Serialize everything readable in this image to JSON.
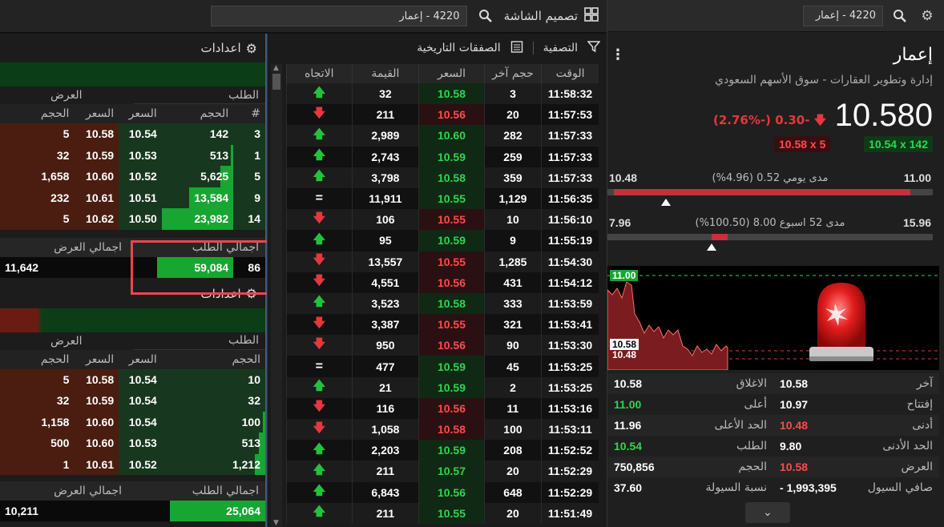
{
  "dashboard": {
    "title": "تصميم الشاشة",
    "search_value": "4220 - إعمار"
  },
  "stock": {
    "search_value": "4220 - إعمار",
    "name": "إعمار",
    "sector": "إدارة وتطوير العقارات - سوق الأسهم السعودي",
    "last": "10.580",
    "change": "0.30-",
    "change_pct": "(2.76%-)",
    "bid": "10.54 x 142",
    "ask": "10.58 x 5",
    "day_range": {
      "low": "10.48",
      "high": "11.00",
      "label": "مدى يومي 0.52 (4.96%)",
      "fill_from": 0.02,
      "fill_to": 0.93,
      "marker": 0.18
    },
    "week52_range": {
      "low": "7.96",
      "high": "15.96",
      "label": "مدى 52 اسبوع 8.00 (100.50%)",
      "fill_from": 0.32,
      "fill_to": 0.37,
      "marker": 0.32
    },
    "chart": {
      "top_label": "11.00",
      "price_label": "10.58",
      "prev_label": "10.48"
    },
    "stats": [
      {
        "l1": "آخر",
        "v1": "10.58",
        "l2": "الاغلاق",
        "v2": "10.58",
        "c1": "#ffffff",
        "c2": "#ffffff"
      },
      {
        "l1": "إفتتاح",
        "v1": "10.97",
        "l2": "أعلى",
        "v2": "11.00",
        "c1": "#ffffff",
        "c2": "#2ed54e"
      },
      {
        "l1": "أدنى",
        "v1": "10.48",
        "l2": "الحد الأعلى",
        "v2": "11.96",
        "c1": "#ff4a4a",
        "c2": "#ffffff"
      },
      {
        "l1": "الحد الأدنى",
        "v1": "9.80",
        "l2": "الطلب",
        "v2": "10.54",
        "c1": "#ffffff",
        "c2": "#2ed54e"
      },
      {
        "l1": "العرض",
        "v1": "10.58",
        "l2": "الحجم",
        "v2": "750,856",
        "c1": "#ff4a4a",
        "c2": "#ffffff"
      },
      {
        "l1": "صافي السيول",
        "v1": "1,993,395 -",
        "l2": "نسبة السيولة",
        "v2": "37.60",
        "c1": "#ffffff",
        "c2": "#ffffff"
      }
    ]
  },
  "trades": {
    "filter_label": "التصفية",
    "history_label": "الصفقات التاريخية",
    "headers": {
      "time": "الوقت",
      "volume": "حجم آخر",
      "price": "السعر",
      "value": "القيمة",
      "direction": "الاتجاه"
    },
    "rows": [
      {
        "time": "11:58:32",
        "volume": "3",
        "price": "10.58",
        "value": "32",
        "dir": "up"
      },
      {
        "time": "11:57:53",
        "volume": "20",
        "price": "10.56",
        "value": "211",
        "dir": "down"
      },
      {
        "time": "11:57:33",
        "volume": "282",
        "price": "10.60",
        "value": "2,989",
        "dir": "up"
      },
      {
        "time": "11:57:33",
        "volume": "259",
        "price": "10.59",
        "value": "2,743",
        "dir": "up"
      },
      {
        "time": "11:57:33",
        "volume": "359",
        "price": "10.58",
        "value": "3,798",
        "dir": "up"
      },
      {
        "time": "11:56:35",
        "volume": "1,129",
        "price": "10.55",
        "value": "11,911",
        "dir": "eq"
      },
      {
        "time": "11:56:10",
        "volume": "10",
        "price": "10.55",
        "value": "106",
        "dir": "down"
      },
      {
        "time": "11:55:19",
        "volume": "9",
        "price": "10.59",
        "value": "95",
        "dir": "up"
      },
      {
        "time": "11:54:30",
        "volume": "1,285",
        "price": "10.55",
        "value": "13,557",
        "dir": "down"
      },
      {
        "time": "11:54:12",
        "volume": "431",
        "price": "10.56",
        "value": "4,551",
        "dir": "down"
      },
      {
        "time": "11:53:59",
        "volume": "333",
        "price": "10.58",
        "value": "3,523",
        "dir": "up"
      },
      {
        "time": "11:53:41",
        "volume": "321",
        "price": "10.55",
        "value": "3,387",
        "dir": "down"
      },
      {
        "time": "11:53:30",
        "volume": "90",
        "price": "10.56",
        "value": "950",
        "dir": "down"
      },
      {
        "time": "11:53:25",
        "volume": "45",
        "price": "10.59",
        "value": "477",
        "dir": "eq"
      },
      {
        "time": "11:53:25",
        "volume": "2",
        "price": "10.59",
        "value": "21",
        "dir": "up"
      },
      {
        "time": "11:53:16",
        "volume": "11",
        "price": "10.56",
        "value": "116",
        "dir": "down"
      },
      {
        "time": "11:53:11",
        "volume": "100",
        "price": "10.58",
        "value": "1,058",
        "dir": "down"
      },
      {
        "time": "11:52:52",
        "volume": "208",
        "price": "10.59",
        "value": "2,203",
        "dir": "up"
      },
      {
        "time": "11:52:29",
        "volume": "20",
        "price": "10.57",
        "value": "211",
        "dir": "up"
      },
      {
        "time": "11:52:29",
        "volume": "648",
        "price": "10.56",
        "value": "6,843",
        "dir": "up"
      },
      {
        "time": "11:51:49",
        "volume": "20",
        "price": "10.55",
        "value": "211",
        "dir": "up"
      }
    ]
  },
  "book1": {
    "settings_label": "اعدادات",
    "bid_label": "الطلب",
    "ask_label": "العرض",
    "cols": {
      "count": "#",
      "bid_vol": "الحجم",
      "bid_price": "السعر",
      "ask_price": "السعر",
      "ask_vol": "الحجم"
    },
    "rows": [
      {
        "count": "3",
        "bid_vol": "142",
        "bid_price": "10.54",
        "ask_price": "10.58",
        "ask_vol": "5",
        "fill": 0.0
      },
      {
        "count": "1",
        "bid_vol": "513",
        "bid_price": "10.53",
        "ask_price": "10.59",
        "ask_vol": "32",
        "fill": 0.04
      },
      {
        "count": "5",
        "bid_vol": "5,625",
        "bid_price": "10.52",
        "ask_price": "10.60",
        "ask_vol": "1,658",
        "fill": 0.18
      },
      {
        "count": "9",
        "bid_vol": "13,584",
        "bid_price": "10.51",
        "ask_price": "10.61",
        "ask_vol": "232",
        "fill": 0.62
      },
      {
        "count": "14",
        "bid_vol": "23,982",
        "bid_price": "10.50",
        "ask_price": "10.62",
        "ask_vol": "5",
        "fill": 1.0
      }
    ],
    "total_bid_label": "اجمالي الطلب",
    "total_ask_label": "اجمالي العرض",
    "total_count": "86",
    "total_bid": "59,084",
    "total_ask": "11,642"
  },
  "book2": {
    "settings_label": "اعدادات",
    "bid_label": "الطلب",
    "ask_label": "العرض",
    "cols": {
      "bid_vol": "الحجم",
      "bid_price": "السعر",
      "ask_price": "السعر",
      "ask_vol": "الحجم"
    },
    "rows": [
      {
        "bid_vol": "10",
        "bid_price": "10.54",
        "ask_price": "10.58",
        "ask_vol": "5",
        "fill": 0.0
      },
      {
        "bid_vol": "32",
        "bid_price": "10.54",
        "ask_price": "10.59",
        "ask_vol": "32",
        "fill": 0.0
      },
      {
        "bid_vol": "100",
        "bid_price": "10.54",
        "ask_price": "10.60",
        "ask_vol": "1,158",
        "fill": 0.02
      },
      {
        "bid_vol": "513",
        "bid_price": "10.53",
        "ask_price": "10.60",
        "ask_vol": "500",
        "fill": 0.06
      },
      {
        "bid_vol": "1,212",
        "bid_price": "10.52",
        "ask_price": "10.61",
        "ask_vol": "1",
        "fill": 0.1
      }
    ],
    "total_bid_label": "اجمالي الطلب",
    "total_ask_label": "اجمالي العرض",
    "total_bid": "25,064",
    "total_ask": "10,211"
  },
  "colors": {
    "up": "#2ed54e",
    "down": "#ff4a4a",
    "bid_bg": "#17381e",
    "ask_bg": "#4a1d10",
    "highlight": "#e8474f"
  }
}
